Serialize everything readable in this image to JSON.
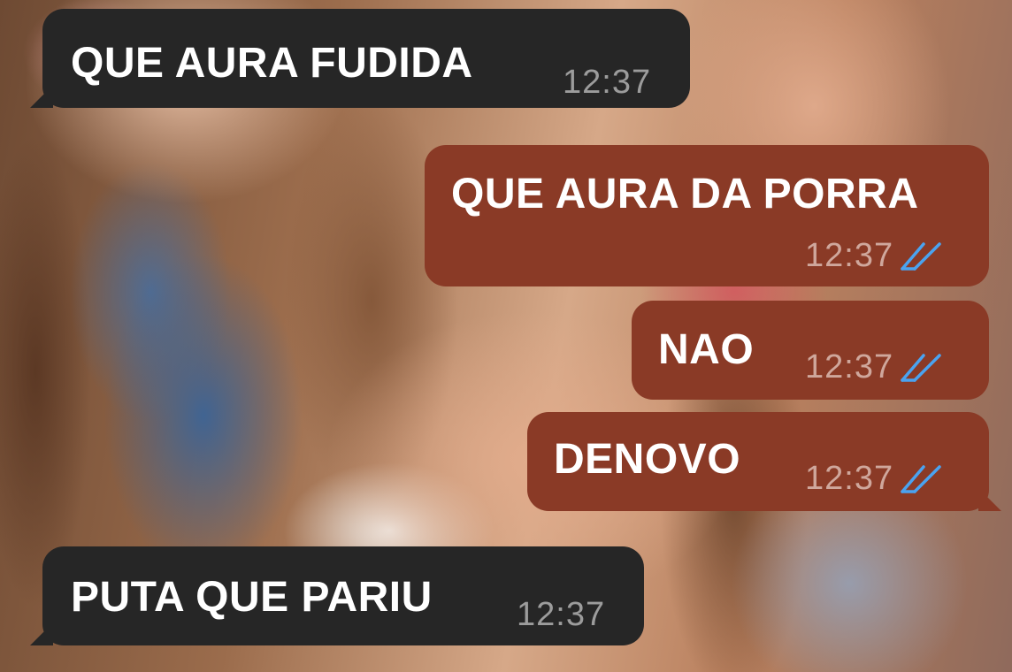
{
  "colors": {
    "incoming_bubble": "#262626",
    "outgoing_bubble": "#8a3a26",
    "message_text": "#ffffff",
    "incoming_time": "#9c9c9c",
    "outgoing_time": "#cfa79c",
    "read_ticks": "#4aa3f0"
  },
  "messages": [
    {
      "direction": "incoming",
      "text": "QUE AURA FUDIDA",
      "time": "12:37"
    },
    {
      "direction": "outgoing",
      "text": "QUE AURA DA PORRA",
      "time": "12:37",
      "status_icon": "double-check-read-icon"
    },
    {
      "direction": "outgoing",
      "text": "NAO",
      "time": "12:37",
      "status_icon": "double-check-read-icon"
    },
    {
      "direction": "outgoing",
      "text": "DENOVO",
      "time": "12:37",
      "status_icon": "double-check-read-icon"
    },
    {
      "direction": "incoming",
      "text": "PUTA QUE PARIU",
      "time": "12:37"
    }
  ]
}
